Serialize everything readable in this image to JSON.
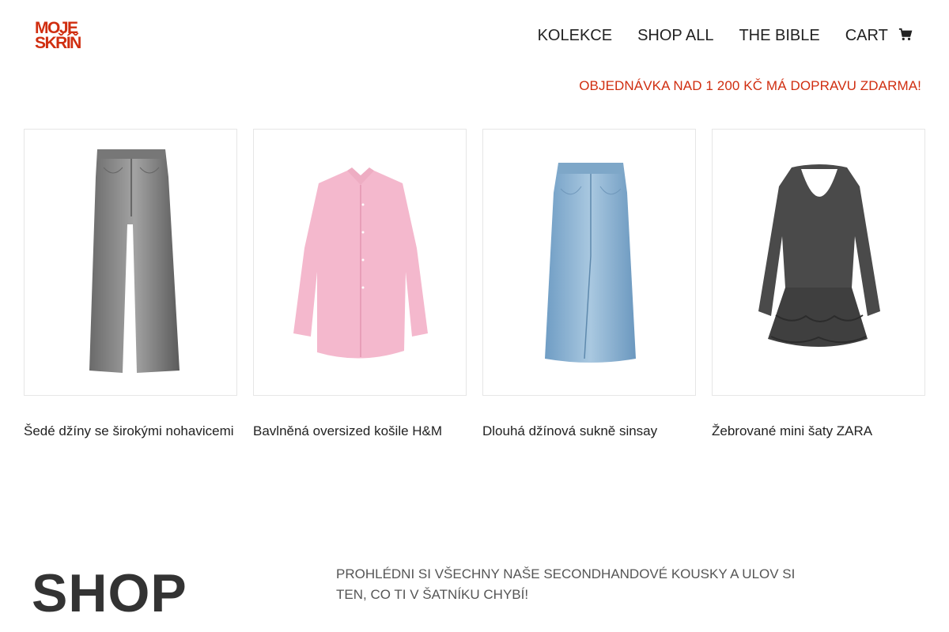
{
  "brand": {
    "logo_line1": "MOJE",
    "logo_line2": "SKŘÍŇ",
    "accent_color": "#d02e10"
  },
  "nav": {
    "items": [
      {
        "label": "KOLEKCE"
      },
      {
        "label": "SHOP ALL"
      },
      {
        "label": "THE BIBLE"
      }
    ],
    "cart_label": "CART",
    "cart_icon": "shopping-cart-icon"
  },
  "promo_banner": "OBJEDNÁVKA NAD 1 200 KČ MÁ DOPRAVU ZDARMA!",
  "products": [
    {
      "title": "Šedé džíny se širokými nohavicemi",
      "image": "grey-wide-leg-jeans"
    },
    {
      "title": "Bavlněná oversized košile H&M",
      "image": "pink-oversized-shirt"
    },
    {
      "title": "Dlouhá džínová sukně sinsay",
      "image": "long-denim-skirt"
    },
    {
      "title": "Žebrované mini šaty ZARA",
      "image": "ribbed-mini-dress"
    }
  ],
  "shop_section": {
    "heading": "SHOP",
    "description": "PROHLÉDNI SI VŠECHNY NAŠE SECONDHANDOVÉ KOUSKY A ULOV SI TEN, CO TI V ŠATNÍKU CHYBÍ!"
  }
}
